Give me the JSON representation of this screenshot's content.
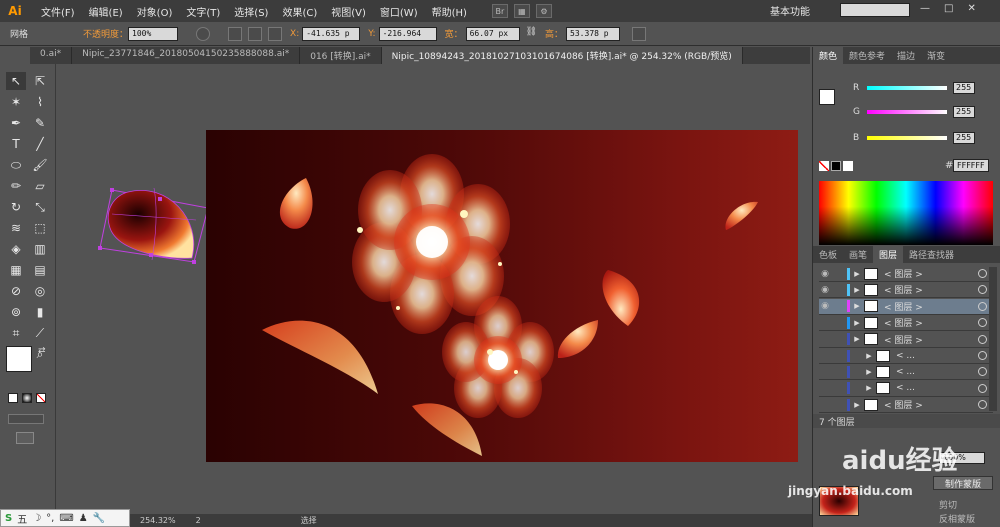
{
  "app": {
    "logo": "Ai",
    "workspace": "基本功能"
  },
  "menu": [
    "文件(F)",
    "编辑(E)",
    "对象(O)",
    "文字(T)",
    "选择(S)",
    "效果(C)",
    "视图(V)",
    "窗口(W)",
    "帮助(H)"
  ],
  "menu_icons": [
    "Br"
  ],
  "control": {
    "selection_label": "网格",
    "opacity_label": "不透明度：",
    "opacity_value": "100%",
    "x_label": "X:",
    "x_value": "-41.635 p",
    "y_label": "Y:",
    "y_value": "-216.964",
    "w_label": "宽：",
    "w_value": "66.07 px",
    "h_label": "高：",
    "h_value": "53.378 p"
  },
  "tabs": [
    "0.ai*",
    "Nipic_23771846_20180504150235888088.ai*",
    "016 [转换].ai*",
    "Nipic_10894243_20181027103101674086 [转换].ai* @ 254.32% (RGB/预览)"
  ],
  "color_panel": {
    "tabs": [
      "颜色",
      "颜色参考",
      "描边",
      "渐变"
    ],
    "r_label": "R",
    "r_value": "255",
    "g_label": "G",
    "g_value": "255",
    "b_label": "B",
    "b_value": "255",
    "hex_value": "FFFFFF"
  },
  "layers_panel": {
    "tabs": [
      "色板",
      "画笔",
      "图层",
      "路径查找器"
    ],
    "rows": [
      {
        "name": "< 图层 >",
        "eye": true,
        "color": "#4fc3f7"
      },
      {
        "name": "< 图层 >",
        "eye": true,
        "color": "#4fc3f7"
      },
      {
        "name": "< 图层 >",
        "eye": true,
        "color": "#e040fb"
      },
      {
        "name": "< 图层 >",
        "eye": false,
        "color": "#2196f3"
      },
      {
        "name": "< 图层 >",
        "eye": false,
        "color": "#3f51b5"
      },
      {
        "name": "< ...",
        "eye": false,
        "color": "#3f51b5"
      },
      {
        "name": "< ...",
        "eye": false,
        "color": "#3f51b5"
      },
      {
        "name": "< ...",
        "eye": false,
        "color": "#3f51b5"
      },
      {
        "name": "< 图层 >",
        "eye": false,
        "color": "#3f51b5"
      }
    ],
    "count_label": "7 个图层",
    "opacity_value": "100%",
    "make_mask_label": "制作蒙版",
    "clip_label": "剪切",
    "invert_label": "反相蒙版"
  },
  "status": {
    "zoom": "254.32%",
    "page": "2",
    "mode": "选择"
  },
  "ime": {
    "text": "五"
  },
  "watermarks": {
    "baidu": "aidu经验",
    "url": "jingyan.baidu.com"
  }
}
